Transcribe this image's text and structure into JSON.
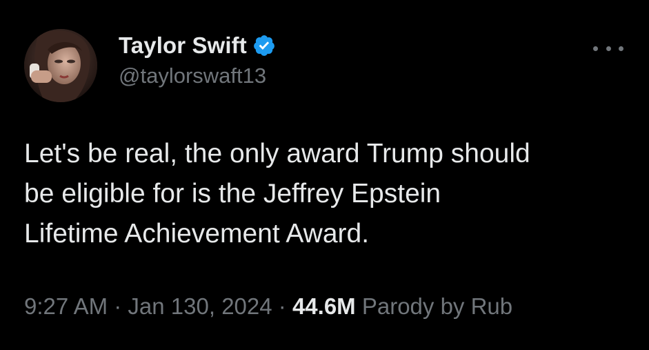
{
  "tweet": {
    "author": {
      "display_name": "Taylor Swift",
      "handle": "@taylorswaft13",
      "verified": true,
      "verified_icon": "verified-badge-icon",
      "verified_color": "#1d9bf0"
    },
    "more_icon": "more-options-icon",
    "text": "Let's be real, the only award Trump should\nbe eligible for is the Jeffrey Epstein\nLifetime Achievement Award.",
    "time": "9:27 AM",
    "separator": "·",
    "date": "Jan 130, 2024",
    "views": "44.6M",
    "views_suffix": "Parody by Rub"
  },
  "colors": {
    "background": "#000000",
    "primary_text": "#e7e9ea",
    "secondary_text": "#71767b",
    "accent": "#1d9bf0"
  }
}
